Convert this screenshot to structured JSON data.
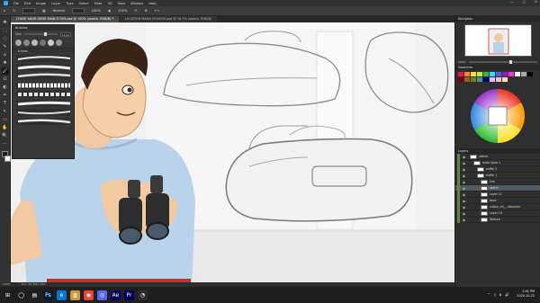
{
  "menu": {
    "items": [
      "File",
      "Edit",
      "Image",
      "Layer",
      "Type",
      "Select",
      "Filter",
      "3D",
      "View",
      "Window",
      "Help"
    ],
    "window_controls": [
      "—",
      "□",
      "✕"
    ]
  },
  "options_bar": {
    "mode_label": "Normal",
    "opacity_label": "100%",
    "flow_label": "100%"
  },
  "tabs": [
    {
      "label": "CHASE ANGR GRMS MAIN 57209.psd @ 100% (sketch, RGB/8) *",
      "active": true
    },
    {
      "label": "LOCATION MAIKA 0526030.psd @ 16.7% (sketch, RGB/8)",
      "active": false
    }
  ],
  "tools": [
    "✥",
    "⬚",
    "◌",
    "✎",
    "⌂",
    "✚",
    "🖌",
    "⎌",
    "◐",
    "✏",
    "T",
    "↖",
    "▭",
    "✋",
    "🔍",
    "⋯"
  ],
  "brush_panel": {
    "title": "Brushes",
    "size_label": "Size",
    "size_value": "11 px",
    "folder_label": "Lines"
  },
  "navigator": {
    "title": "Navigator",
    "zoom": "100%"
  },
  "swatches_title": "Swatches",
  "swatch_colors": [
    "#e6194b",
    "#f58231",
    "#ffe119",
    "#bfef45",
    "#3cb44b",
    "#42d4f4",
    "#4363d8",
    "#911eb4",
    "#f032e6",
    "#ffffff",
    "#a9a9a9",
    "#000000",
    "#800000",
    "#9A6324",
    "#808000",
    "#469990",
    "#000075",
    "#dcbeff",
    "#fabed4",
    "#ffd8b1"
  ],
  "layers": {
    "title": "Layers",
    "items": [
      {
        "name": "sketch",
        "indent": 0,
        "selected": false
      },
      {
        "name": "main store 1",
        "indent": 1,
        "selected": false
      },
      {
        "name": "duffel 2",
        "indent": 2,
        "selected": false
      },
      {
        "name": "duffel 1",
        "indent": 2,
        "selected": false
      },
      {
        "name": "line",
        "indent": 3,
        "selected": false
      },
      {
        "name": "sketch",
        "indent": 3,
        "selected": true
      },
      {
        "name": "Layer 11",
        "indent": 3,
        "selected": false
      },
      {
        "name": "base",
        "indent": 3,
        "selected": false
      },
      {
        "name": "colour_mi_...retouche",
        "indent": 3,
        "selected": false
      },
      {
        "name": "Layer 10",
        "indent": 3,
        "selected": false
      },
      {
        "name": "Texture",
        "indent": 3,
        "selected": false
      }
    ]
  },
  "status": {
    "zoom": "100%",
    "doc": "Doc: 24.3M/1.21G"
  },
  "taskbar": {
    "icons": [
      {
        "glyph": "⊞",
        "color": "#1f1f1f"
      },
      {
        "glyph": "◯",
        "color": "#1f1f1f"
      },
      {
        "glyph": "▤",
        "color": "#1f1f1f"
      },
      {
        "glyph": "Ps",
        "color": "#001e36"
      },
      {
        "glyph": "e",
        "color": "#0078d7"
      },
      {
        "glyph": "▥",
        "color": "#c89b3c"
      },
      {
        "glyph": "◉",
        "color": "#e8453c"
      },
      {
        "glyph": "◎",
        "color": "#5865f2"
      },
      {
        "glyph": "Ae",
        "color": "#00005b"
      },
      {
        "glyph": "Pr",
        "color": "#00005b"
      },
      {
        "glyph": "◔",
        "color": "#2c2c2c"
      }
    ],
    "tray": [
      "⌃",
      "▯",
      "◖",
      "🔊"
    ],
    "time": "2:41 PM",
    "date": "2020-10-22"
  }
}
